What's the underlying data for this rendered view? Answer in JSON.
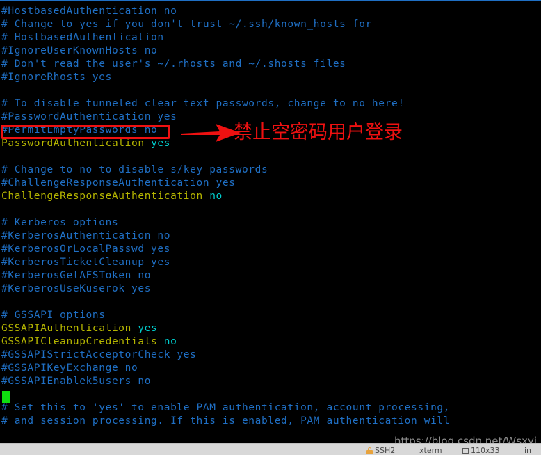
{
  "window": {
    "app": "terminal-emulator",
    "file": "sshd_config"
  },
  "terminal": {
    "background": "#000000",
    "comment_color": "#1f6fc4",
    "keyword_color": "#b5b500",
    "value_color": "#00cdcd",
    "cursor_color": "#0fdf0f",
    "lines": [
      {
        "type": "comment",
        "text": "#HostbasedAuthentication no"
      },
      {
        "type": "comment",
        "text": "# Change to yes if you don't trust ~/.ssh/known_hosts for"
      },
      {
        "type": "comment",
        "text": "# HostbasedAuthentication"
      },
      {
        "type": "comment",
        "text": "#IgnoreUserKnownHosts no"
      },
      {
        "type": "comment",
        "text": "# Don't read the user's ~/.rhosts and ~/.shosts files"
      },
      {
        "type": "comment",
        "text": "#IgnoreRhosts yes"
      },
      {
        "type": "blank",
        "text": ""
      },
      {
        "type": "comment",
        "text": "# To disable tunneled clear text passwords, change to no here!"
      },
      {
        "type": "comment",
        "text": "#PasswordAuthentication yes"
      },
      {
        "type": "comment",
        "text": "#PermitEmptyPasswords no"
      },
      {
        "type": "setting",
        "key": "PasswordAuthentication",
        "value": "yes"
      },
      {
        "type": "blank",
        "text": ""
      },
      {
        "type": "comment",
        "text": "# Change to no to disable s/key passwords"
      },
      {
        "type": "comment",
        "text": "#ChallengeResponseAuthentication yes"
      },
      {
        "type": "setting",
        "key": "ChallengeResponseAuthentication",
        "value": "no"
      },
      {
        "type": "blank",
        "text": ""
      },
      {
        "type": "comment",
        "text": "# Kerberos options"
      },
      {
        "type": "comment",
        "text": "#KerberosAuthentication no"
      },
      {
        "type": "comment",
        "text": "#KerberosOrLocalPasswd yes"
      },
      {
        "type": "comment",
        "text": "#KerberosTicketCleanup yes"
      },
      {
        "type": "comment",
        "text": "#KerberosGetAFSToken no"
      },
      {
        "type": "comment",
        "text": "#KerberosUseKuserok yes"
      },
      {
        "type": "blank",
        "text": ""
      },
      {
        "type": "comment",
        "text": "# GSSAPI options"
      },
      {
        "type": "setting",
        "key": "GSSAPIAuthentication",
        "value": "yes"
      },
      {
        "type": "setting",
        "key": "GSSAPICleanupCredentials",
        "value": "no"
      },
      {
        "type": "comment",
        "text": "#GSSAPIStrictAcceptorCheck yes"
      },
      {
        "type": "comment",
        "text": "#GSSAPIKeyExchange no"
      },
      {
        "type": "comment",
        "text": "#GSSAPIEnablek5users no"
      },
      {
        "type": "blank",
        "text": ""
      },
      {
        "type": "comment",
        "text": "# Set this to 'yes' to enable PAM authentication, account processing,"
      },
      {
        "type": "comment",
        "text": "# and session processing. If this is enabled, PAM authentication will"
      }
    ]
  },
  "annotation": {
    "color": "#ee1111",
    "highlight_target": "#PermitEmptyPasswords no",
    "note_text": "禁止空密码用户登录",
    "arrow_icon": "right-arrow-icon"
  },
  "watermark": {
    "text": "https://blog.csdn.net/Wsxyi"
  },
  "statusbar": {
    "protocol": "SSH2",
    "terminal_type": "xterm",
    "size": "110x33",
    "encoding": "in",
    "lock_icon": "lock-icon",
    "size_icon": "resize-icon"
  }
}
